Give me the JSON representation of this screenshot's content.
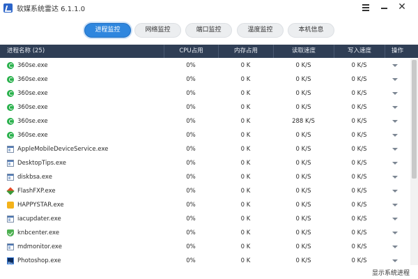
{
  "window": {
    "title": "软媒系统雷达 6.1.1.0",
    "menu_icon": "hamburger-icon",
    "minimize_icon": "minimize-icon",
    "close_glyph": "✕"
  },
  "tabs": [
    {
      "label": "进程监控",
      "active": true
    },
    {
      "label": "网络监控",
      "active": false
    },
    {
      "label": "端口监控",
      "active": false
    },
    {
      "label": "温度监控",
      "active": false
    },
    {
      "label": "本机信息",
      "active": false
    }
  ],
  "table": {
    "headers": {
      "name": "进程名称 (25)",
      "cpu": "CPU占用",
      "mem": "内存占用",
      "read": "读取速度",
      "write": "写入速度",
      "op": "操作"
    },
    "rows": [
      {
        "icon": "360se-icon",
        "name": "360se.exe",
        "cpu": "0%",
        "mem": "0 K",
        "read": "0 K/S",
        "write": "0 K/S"
      },
      {
        "icon": "360se-icon",
        "name": "360se.exe",
        "cpu": "0%",
        "mem": "0 K",
        "read": "0 K/S",
        "write": "0 K/S"
      },
      {
        "icon": "360se-icon",
        "name": "360se.exe",
        "cpu": "0%",
        "mem": "0 K",
        "read": "0 K/S",
        "write": "0 K/S"
      },
      {
        "icon": "360se-icon",
        "name": "360se.exe",
        "cpu": "0%",
        "mem": "0 K",
        "read": "0 K/S",
        "write": "0 K/S"
      },
      {
        "icon": "360se-icon",
        "name": "360se.exe",
        "cpu": "0%",
        "mem": "0 K",
        "read": "288 K/S",
        "write": "0 K/S"
      },
      {
        "icon": "360se-icon",
        "name": "360se.exe",
        "cpu": "0%",
        "mem": "0 K",
        "read": "0 K/S",
        "write": "0 K/S"
      },
      {
        "icon": "app-window-icon",
        "name": "AppleMobileDeviceService.exe",
        "cpu": "0%",
        "mem": "0 K",
        "read": "0 K/S",
        "write": "0 K/S"
      },
      {
        "icon": "app-window-icon",
        "name": "DesktopTips.exe",
        "cpu": "0%",
        "mem": "0 K",
        "read": "0 K/S",
        "write": "0 K/S"
      },
      {
        "icon": "app-window-icon",
        "name": "diskbsa.exe",
        "cpu": "0%",
        "mem": "0 K",
        "read": "0 K/S",
        "write": "0 K/S"
      },
      {
        "icon": "flashfxp-icon",
        "name": "FlashFXP.exe",
        "cpu": "0%",
        "mem": "0 K",
        "read": "0 K/S",
        "write": "0 K/S"
      },
      {
        "icon": "happystar-icon",
        "name": "HAPPYSTAR.exe",
        "cpu": "0%",
        "mem": "0 K",
        "read": "0 K/S",
        "write": "0 K/S"
      },
      {
        "icon": "app-window-icon",
        "name": "iacupdater.exe",
        "cpu": "0%",
        "mem": "0 K",
        "read": "0 K/S",
        "write": "0 K/S"
      },
      {
        "icon": "knbcenter-icon",
        "name": "knbcenter.exe",
        "cpu": "0%",
        "mem": "0 K",
        "read": "0 K/S",
        "write": "0 K/S"
      },
      {
        "icon": "app-window-icon",
        "name": "mdmonitor.exe",
        "cpu": "0%",
        "mem": "0 K",
        "read": "0 K/S",
        "write": "0 K/S"
      },
      {
        "icon": "photoshop-icon",
        "name": "Photoshop.exe",
        "cpu": "0%",
        "mem": "0 K",
        "read": "0 K/S",
        "write": "0 K/S"
      }
    ],
    "op_icon": "dropdown-arrow-icon"
  },
  "footer": {
    "show_system_label": "显示系统进程"
  },
  "colors": {
    "header_bg": "#2f3e55",
    "active_tab": "#2e86de"
  }
}
